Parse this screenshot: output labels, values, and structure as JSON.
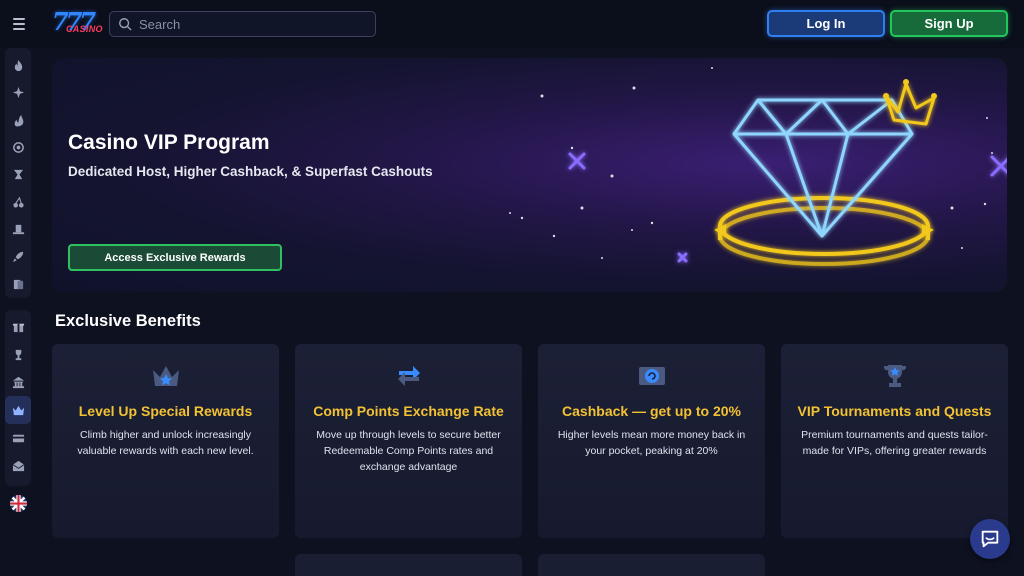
{
  "header": {
    "search_placeholder": "Search",
    "login_label": "Log In",
    "signup_label": "Sign Up"
  },
  "sidebar": {
    "group1": [
      "flame-icon",
      "sparkle-icon",
      "fire-icon",
      "target-icon",
      "slot-icon",
      "cherries-icon",
      "hat-icon",
      "rocket-icon",
      "cards-icon"
    ],
    "group2": [
      "gift-icon",
      "trophy-icon",
      "bank-icon",
      "vip-crown-icon",
      "card-icon",
      "mail-icon"
    ],
    "active": "vip-crown-icon"
  },
  "hero": {
    "title": "Casino VIP Program",
    "subtitle": "Dedicated Host, Higher Cashback, & Superfast Cashouts",
    "cta_label": "Access Exclusive Rewards"
  },
  "benefits": {
    "section_title": "Exclusive Benefits",
    "cards": [
      {
        "icon": "crown-icon",
        "title": "Level Up Special Rewards",
        "desc": "Climb higher and unlock increasingly valuable rewards with each new level."
      },
      {
        "icon": "exchange-arrows-icon",
        "title": "Comp Points Exchange Rate",
        "desc": "Move up through levels to secure better Redeemable Comp Points rates and exchange advantage"
      },
      {
        "icon": "cashback-coin-icon",
        "title": "Cashback — get up to 20%",
        "desc": "Higher levels mean more money back in your pocket, peaking at 20%"
      },
      {
        "icon": "trophy-cup-icon",
        "title": "VIP Tournaments and Quests",
        "desc": "Premium tournaments and quests tailor-made for VIPs, offering greater rewards"
      }
    ]
  },
  "colors": {
    "accent_gold": "#f3c233",
    "login_blue": "#2f7ff2",
    "signup_green": "#23c45e",
    "background": "#0e1120"
  }
}
